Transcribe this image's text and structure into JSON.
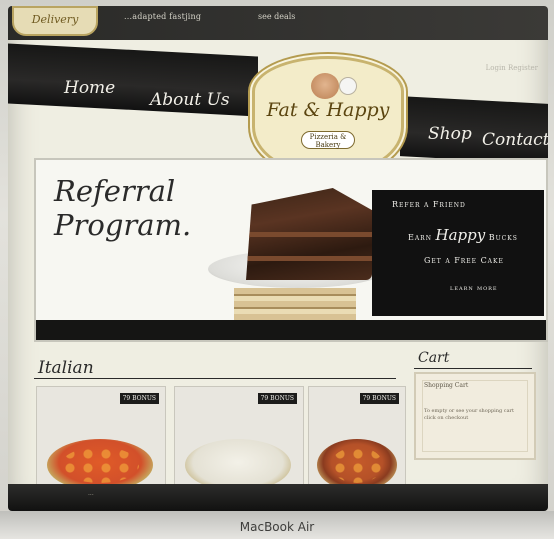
{
  "header": {
    "badge": "Delivery",
    "tagline": "...adapted fastjing",
    "phone": "see deals",
    "right_links": "Login   Register"
  },
  "nav": {
    "home": "Home",
    "about": "About Us",
    "shop": "Shop",
    "contact": "Contact"
  },
  "logo": {
    "title": "Fat & Happy",
    "sub": "Pizzeria & Bakery"
  },
  "hero": {
    "heading_line1": "Referral",
    "heading_line2": "Program.",
    "menu": {
      "refer": "Refer a Friend",
      "earn_pre": "Earn",
      "earn_script": "Happy",
      "earn_post": "Bucks",
      "free": "Get a Free Cake",
      "learn": "learn more"
    }
  },
  "italian": {
    "title": "Italian",
    "products": [
      {
        "price": "79 BONUS"
      },
      {
        "price": "79 BONUS"
      },
      {
        "price": "79 BONUS"
      }
    ]
  },
  "cart": {
    "title": "Cart",
    "line1": "Shopping Cart",
    "line2": "To empty or see your shopping cart click on checkout"
  },
  "footer": {
    "text": "..."
  },
  "device": {
    "label": "MacBook Air"
  },
  "colors": {
    "ribbon": "#1b1b1a",
    "accent_gold": "#c8b36e",
    "page_bg": "#efeee2"
  }
}
